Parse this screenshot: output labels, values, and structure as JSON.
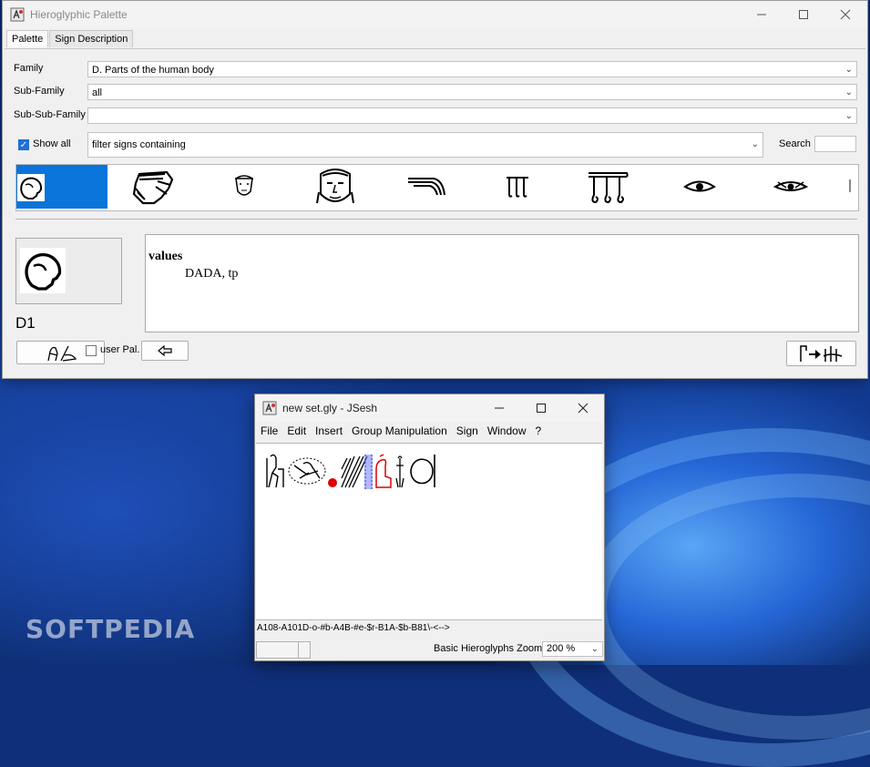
{
  "palette_window": {
    "title": "Hieroglyphic Palette",
    "tabs": [
      "Palette",
      "Sign Description"
    ],
    "family_label": "Family",
    "family_value": "D. Parts of the human body",
    "subfamily_label": "Sub-Family",
    "subfamily_value": "all",
    "subsubfamily_label": "Sub-Sub-Family",
    "subsubfamily_value": "",
    "show_all_label": "Show all",
    "show_all_checked": true,
    "filter_value": "filter signs containing",
    "search_label": "Search",
    "search_value": "",
    "signs": [
      "D1",
      "D2",
      "D3",
      "D4",
      "D5",
      "D6",
      "D7",
      "D8",
      "D9"
    ],
    "selected_sign": "D1",
    "values_heading": "values",
    "values_text": "DADA, tp",
    "user_pal_label": "user Pal.",
    "user_pal_checked": false
  },
  "jsesh_window": {
    "title": "new set.gly - JSesh",
    "menu": [
      "File",
      "Edit",
      "Insert",
      "Group Manipulation",
      "Sign",
      "Window",
      "?"
    ],
    "code": "A108-A101D-o-#b-A4B-#e-$r-B1A-$b-B81\\-<-->",
    "status_label": "Basic Hieroglyphs Zoom",
    "zoom_value": "200 %"
  },
  "watermark": "SOFTPEDIA",
  "colors": {
    "selection": "#0a74da",
    "checkbox": "#1f6fd6",
    "red_glyph": "#e00000",
    "highlight": "#6f7cf5"
  }
}
